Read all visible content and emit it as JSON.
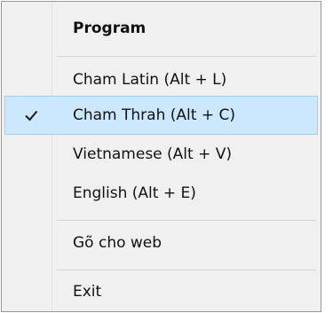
{
  "menu": {
    "items": [
      {
        "label": "Program",
        "header": true
      },
      {
        "label": "Cham Latin (Alt + L)"
      },
      {
        "label": "Cham Thrah (Alt + C)",
        "checked": true
      },
      {
        "label": "Vietnamese (Alt + V)"
      },
      {
        "label": "English (Alt + E)"
      },
      {
        "label": "Gõ cho web"
      },
      {
        "label": "Exit"
      }
    ],
    "check_icon": "checkmark-icon",
    "colors": {
      "background": "#f0f0f0",
      "border": "#979797",
      "selected_fill": "#cce8ff",
      "selected_border": "#99d1ff",
      "separator": "#d4d4d4"
    }
  }
}
